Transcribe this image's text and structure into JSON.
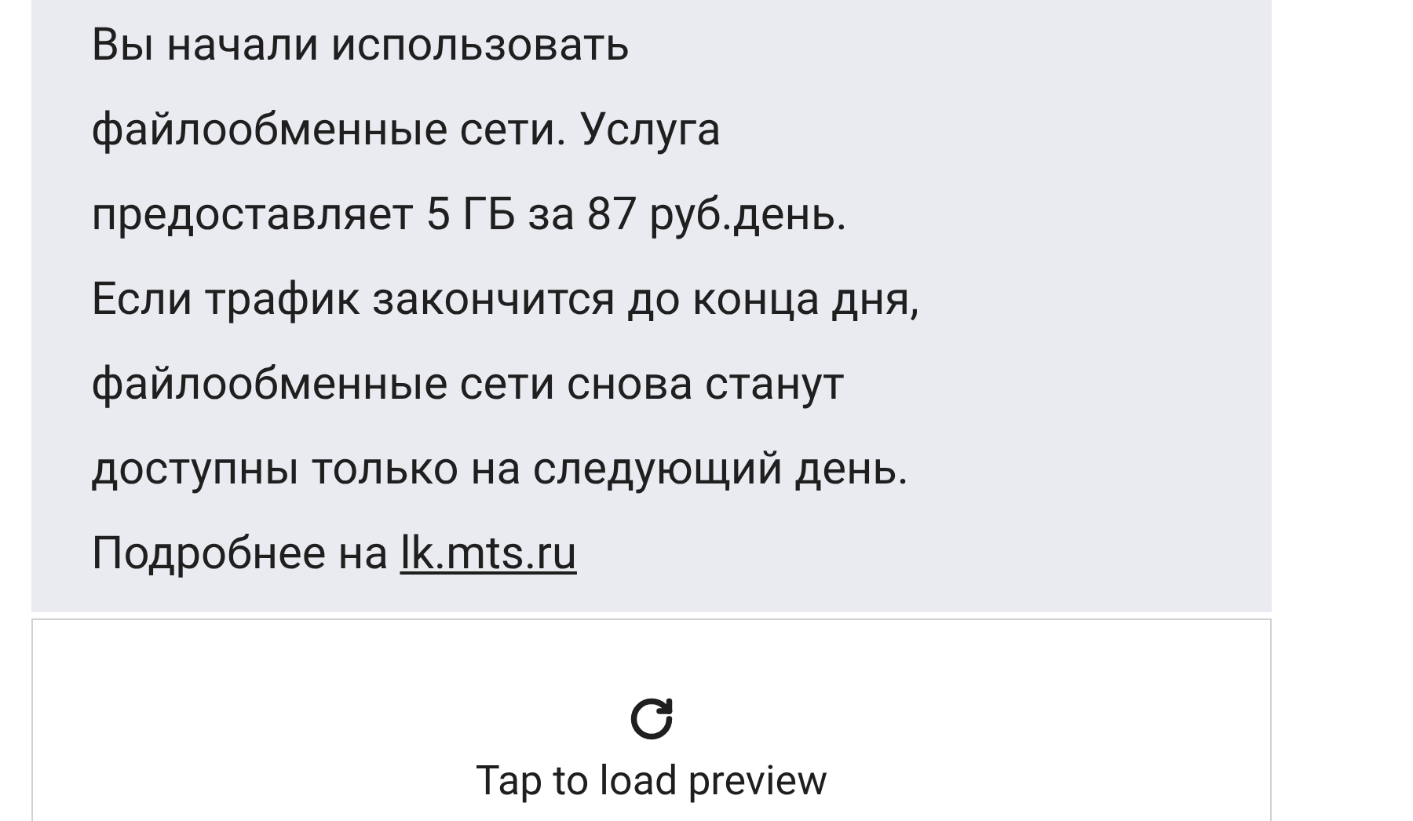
{
  "message": {
    "lines": [
      "Вы начали использовать",
      "файлообменные сети. Услуга",
      "предоставляет 5 ГБ за 87 руб.день.",
      "Если трафик закончится до конца дня,",
      "файлообменные сети снова станут",
      "доступны только на следующий день.",
      "Подробнее на"
    ],
    "link": "lk.mts.ru"
  },
  "preview": {
    "label": "Tap to load preview"
  }
}
